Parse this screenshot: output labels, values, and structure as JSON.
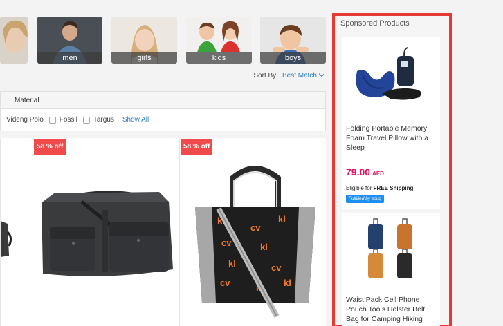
{
  "categories": [
    {
      "label": ""
    },
    {
      "label": "men"
    },
    {
      "label": "girls"
    },
    {
      "label": "kids"
    },
    {
      "label": "boys"
    }
  ],
  "sort": {
    "label": "Sort By:",
    "value": "Best Match"
  },
  "filters": {
    "header": "Material",
    "options": [
      "Videng Polo",
      "Fossil",
      "Targus"
    ],
    "show_all": "Show All"
  },
  "products": [
    {
      "discount": "58 % off"
    },
    {
      "discount": "58 % off"
    }
  ],
  "sponsored": {
    "title": "Sponsored Products",
    "items": [
      {
        "name": "Folding Portable Memory Foam Travel Pillow with a Sleep",
        "price": "79.00",
        "currency": "AED",
        "eligible": "Eligible for",
        "shipping": "FREE Shipping",
        "fulfilled": "Fulfilled by souq"
      },
      {
        "name": "Waist Pack Cell Phone Pouch Tools Holster Belt Bag for Camping Hiking"
      }
    ]
  }
}
